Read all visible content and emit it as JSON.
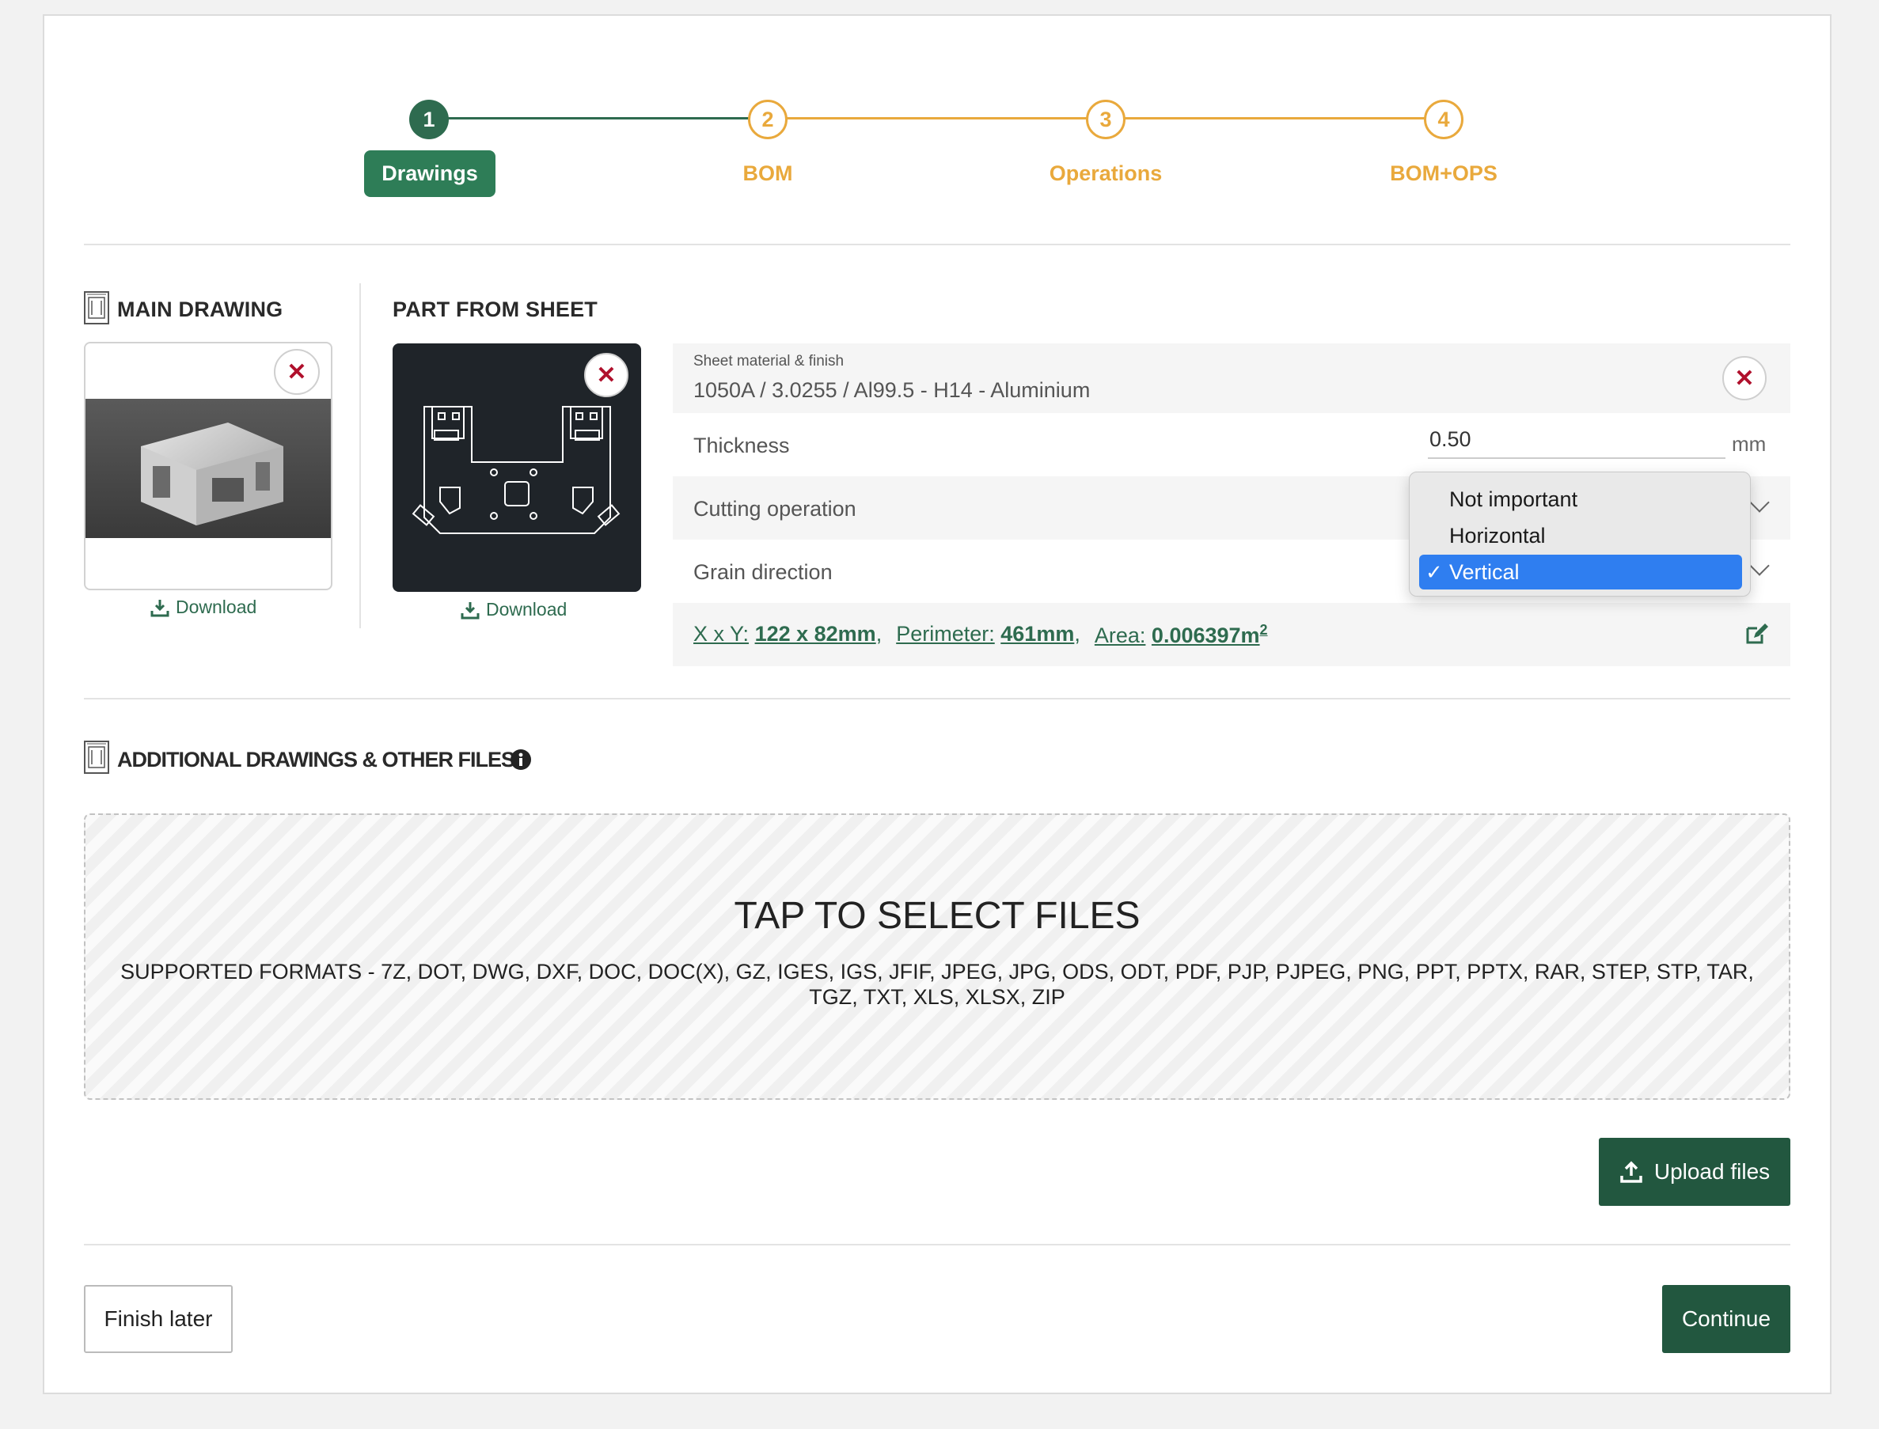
{
  "stepper": {
    "steps": [
      {
        "number": "1",
        "label": "Drawings"
      },
      {
        "number": "2",
        "label": "BOM"
      },
      {
        "number": "3",
        "label": "Operations"
      },
      {
        "number": "4",
        "label": "BOM+OPS"
      }
    ],
    "colors": {
      "active": "#2e6b4f",
      "future": "#e9a93c"
    }
  },
  "main_drawing": {
    "title": "MAIN DRAWING",
    "download_label": "Download",
    "remove_icon": "close-icon"
  },
  "part_from_sheet": {
    "title": "PART FROM SHEET",
    "download_label": "Download",
    "remove_icon": "close-icon"
  },
  "properties": {
    "material_caption": "Sheet material & finish",
    "material_value": "1050A / 3.0255 / Al99.5 - H14 - Aluminium",
    "thickness_label": "Thickness",
    "thickness_value": "0.50",
    "thickness_unit": "mm",
    "cutting_label": "Cutting operation",
    "grain_label": "Grain direction",
    "grain_options": [
      "Not important",
      "Horizontal",
      "Vertical"
    ],
    "grain_selected": "Vertical",
    "check_mark": "✓",
    "dims": {
      "xy_key": "X x Y:",
      "xy_value": "122 x 82mm",
      "perimeter_key": "Perimeter:",
      "perimeter_value": "461mm",
      "area_key": "Area:",
      "area_value": "0.006397m",
      "area_sup": "2"
    }
  },
  "additional": {
    "title": "ADDITIONAL DRAWINGS & OTHER FILES",
    "dropzone_title": "TAP TO SELECT FILES",
    "dropzone_formats": "SUPPORTED FORMATS - 7Z, DOT, DWG, DXF, DOC, DOC(X), GZ, IGES, IGS, JFIF, JPEG, JPG, ODS, ODT, PDF, PJP, PJPEG, PNG, PPT, PPTX, RAR, STEP, STP, TAR, TGZ, TXT, XLS, XLSX, ZIP",
    "upload_label": "Upload files"
  },
  "footer": {
    "finish_later": "Finish later",
    "continue": "Continue"
  }
}
